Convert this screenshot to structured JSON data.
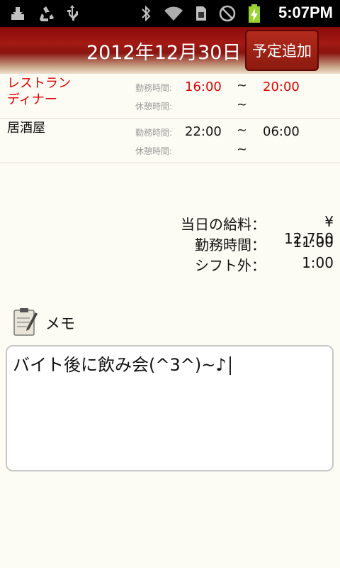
{
  "status_bar": {
    "time": "5:07PM",
    "icons": [
      "download-icon",
      "recycle-icon",
      "usb-icon",
      "bluetooth-icon",
      "wifi-icon",
      "sim-icon",
      "no-signal-icon",
      "battery-charging-icon"
    ]
  },
  "header": {
    "date": "2012年12月30日",
    "add_button": "予定追加"
  },
  "shifts": [
    {
      "name": "レストラン\nディナー",
      "work_label": "勤務時間:",
      "work_start": "16:00",
      "work_sep": "~",
      "work_end": "20:00",
      "break_label": "休憩時間:",
      "break_sep": "~",
      "color": "#e00000"
    },
    {
      "name": "居酒屋",
      "work_label": "勤務時間:",
      "work_start": "22:00",
      "work_sep": "~",
      "work_end": "06:00",
      "break_label": "休憩時間:",
      "break_sep": "~",
      "color": "#111111"
    }
  ],
  "summary": {
    "salary_label": "当日の給料：",
    "salary_value": "¥ 12,750",
    "hours_label": "勤務時間：",
    "hours_value": "11:00",
    "offshift_label": "シフト外：",
    "offshift_value": "1:00"
  },
  "memo": {
    "label": "メモ",
    "text": "バイト後に飲み会(^3^)~♪"
  }
}
